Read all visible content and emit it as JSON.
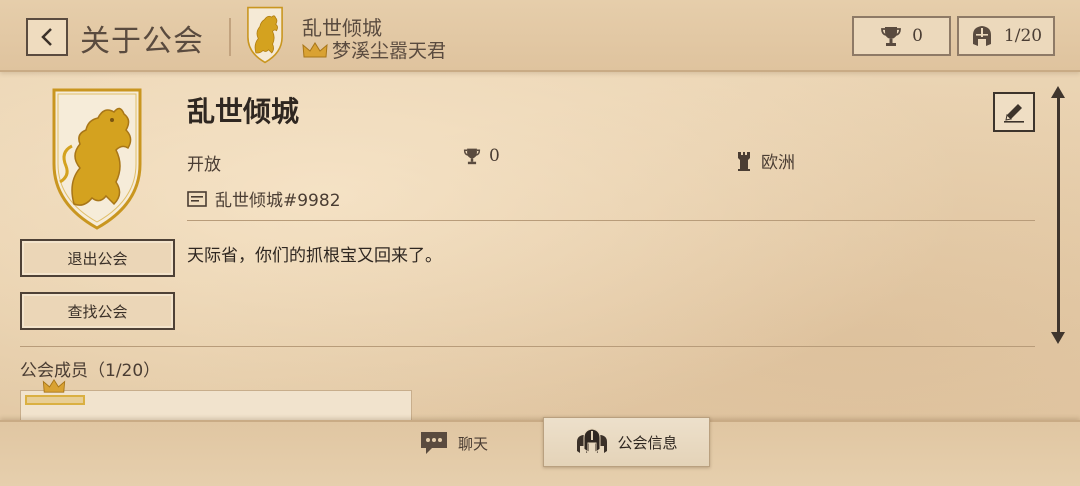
{
  "header": {
    "title": "关于公会",
    "guild_name": "乱世倾城",
    "leader_name": "梦溪尘嚣天君",
    "trophy_count": "0",
    "member_count": "1/20"
  },
  "guild": {
    "name": "乱世倾城",
    "status": "开放",
    "trophies": "0",
    "region": "欧洲",
    "tag": "乱世倾城#9982",
    "description": "天际省，你们的抓根宝又回来了。"
  },
  "actions": {
    "leave_label": "退出公会",
    "find_label": "查找公会"
  },
  "members": {
    "title": "公会成员（1/20）"
  },
  "tabs": {
    "chat_label": "聊天",
    "info_label": "公会信息"
  },
  "colors": {
    "parchment": "#e9d3b2",
    "gold": "#d4a21f",
    "dark_ink": "#3b3129"
  },
  "icons": [
    "back-icon",
    "lion-emblem-icon",
    "crown-icon",
    "trophy-icon",
    "helmet-icon",
    "edit-pencil-icon",
    "tower-icon",
    "id-card-icon",
    "chat-bubble-icon",
    "guild-helmets-icon"
  ]
}
